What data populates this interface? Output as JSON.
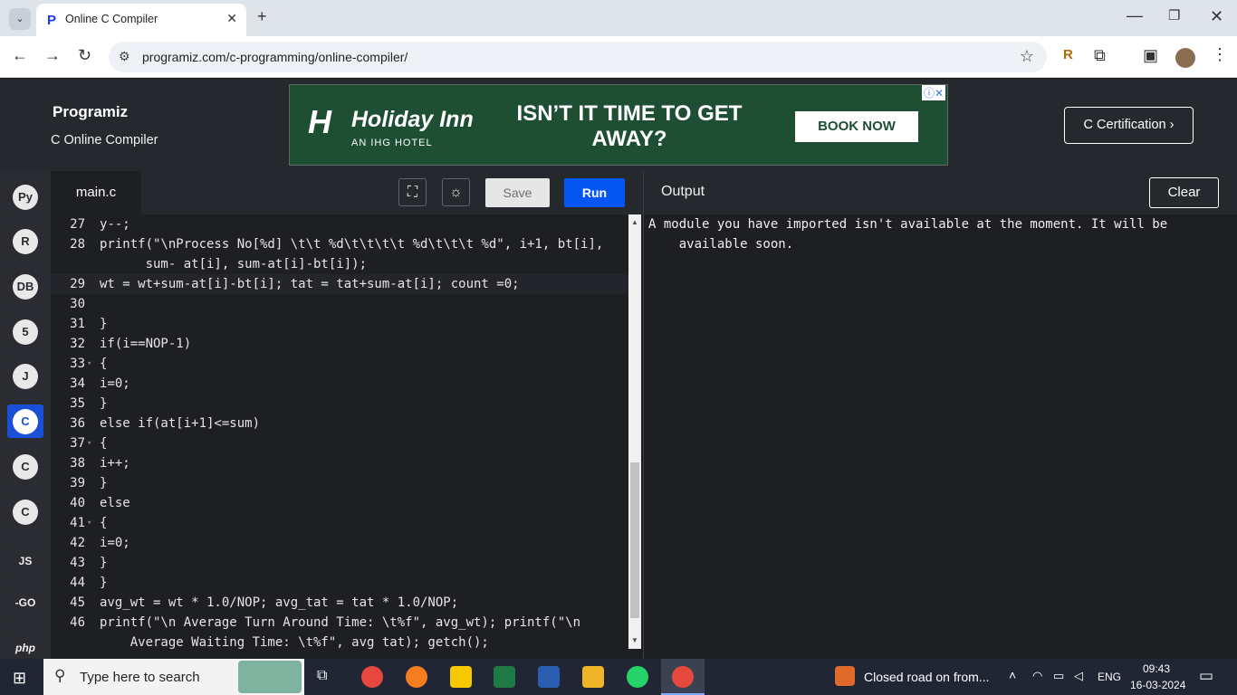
{
  "browser": {
    "tab_title": "Online C Compiler",
    "url": "programiz.com/c-programming/online-compiler/"
  },
  "site": {
    "logo": "Programiz",
    "subtitle": "C Online Compiler",
    "cert_button": "C Certification ›",
    "ad": {
      "brand": "Holiday Inn",
      "brand_sub": "AN IHG HOTEL",
      "headline": "ISN’T IT TIME TO GET AWAY?",
      "cta": "BOOK NOW"
    }
  },
  "sidebar": {
    "items": [
      {
        "name": "python",
        "glyph": "Py"
      },
      {
        "name": "r",
        "glyph": "R"
      },
      {
        "name": "sql",
        "glyph": "DB"
      },
      {
        "name": "html",
        "glyph": "5"
      },
      {
        "name": "java",
        "glyph": "J"
      },
      {
        "name": "c",
        "glyph": "C"
      },
      {
        "name": "cpp",
        "glyph": "C"
      },
      {
        "name": "csharp",
        "glyph": "C"
      },
      {
        "name": "js",
        "glyph": "JS"
      },
      {
        "name": "go",
        "glyph": "-GO"
      },
      {
        "name": "php",
        "glyph": "php"
      }
    ]
  },
  "editor": {
    "filename": "main.c",
    "save_label": "Save",
    "run_label": "Run",
    "lines": [
      {
        "n": "27",
        "fold": "",
        "code": "y--;"
      },
      {
        "n": "28",
        "fold": "",
        "code": "printf(\"\\nProcess No[%d] \\t\\t %d\\t\\t\\t\\t %d\\t\\t\\t %d\", i+1, bt[i],"
      },
      {
        "n": "",
        "fold": "",
        "code": "      sum- at[i], sum-at[i]-bt[i]);"
      },
      {
        "n": "29",
        "fold": "",
        "code": "wt = wt+sum-at[i]-bt[i]; tat = tat+sum-at[i]; count =0;"
      },
      {
        "n": "30",
        "fold": "",
        "code": ""
      },
      {
        "n": "31",
        "fold": "",
        "code": "}"
      },
      {
        "n": "32",
        "fold": "",
        "code": "if(i==NOP-1)"
      },
      {
        "n": "33",
        "fold": "▾",
        "code": "{"
      },
      {
        "n": "34",
        "fold": "",
        "code": "i=0;"
      },
      {
        "n": "35",
        "fold": "",
        "code": "}"
      },
      {
        "n": "36",
        "fold": "",
        "code": "else if(at[i+1]<=sum)"
      },
      {
        "n": "37",
        "fold": "▾",
        "code": "{"
      },
      {
        "n": "38",
        "fold": "",
        "code": "i++;"
      },
      {
        "n": "39",
        "fold": "",
        "code": "}"
      },
      {
        "n": "40",
        "fold": "",
        "code": "else"
      },
      {
        "n": "41",
        "fold": "▾",
        "code": "{"
      },
      {
        "n": "42",
        "fold": "",
        "code": "i=0;"
      },
      {
        "n": "43",
        "fold": "",
        "code": "}"
      },
      {
        "n": "44",
        "fold": "",
        "code": "}"
      },
      {
        "n": "45",
        "fold": "",
        "code": "avg_wt = wt * 1.0/NOP; avg_tat = tat * 1.0/NOP;"
      },
      {
        "n": "46",
        "fold": "",
        "code": "printf(\"\\n Average Turn Around Time: \\t%f\", avg_wt); printf(\"\\n"
      },
      {
        "n": "",
        "fold": "",
        "code": "    Average Waiting Time: \\t%f\", avg_tat); getch();"
      }
    ]
  },
  "output": {
    "title": "Output",
    "clear_label": "Clear",
    "text_line1": "A module you have imported isn't available at the moment. It will be",
    "text_line2": "    available soon."
  },
  "taskbar": {
    "search_placeholder": "Type here to search",
    "weather_text": "Closed road on from...",
    "lang": "ENG",
    "time": "09:43",
    "date": "16-03-2024"
  }
}
